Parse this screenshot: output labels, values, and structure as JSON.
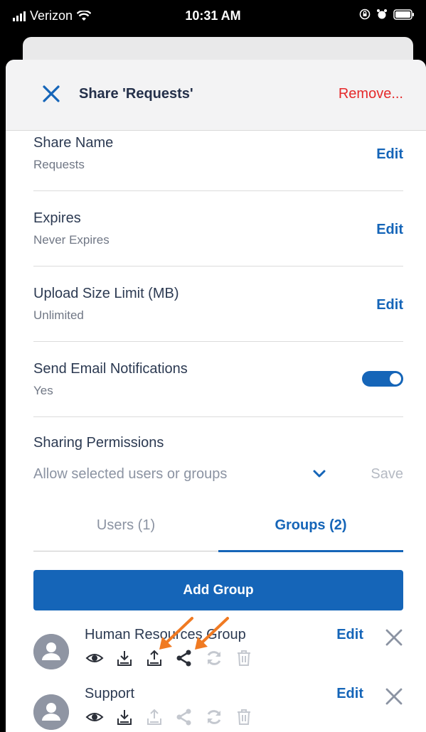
{
  "status_bar": {
    "carrier": "Verizon",
    "time": "10:31 AM"
  },
  "header": {
    "title": "Share 'Requests'",
    "remove_label": "Remove..."
  },
  "settings": [
    {
      "label": "Share Name",
      "value": "Requests",
      "action": "Edit"
    },
    {
      "label": "Expires",
      "value": "Never Expires",
      "action": "Edit"
    },
    {
      "label": "Upload Size Limit (MB)",
      "value": "Unlimited",
      "action": "Edit"
    },
    {
      "label": "Send Email Notifications",
      "value": "Yes",
      "toggle_on": true
    }
  ],
  "permissions": {
    "label": "Sharing Permissions",
    "selected": "Allow selected users or groups",
    "save_label": "Save"
  },
  "tabs": [
    {
      "label": "Users (1)",
      "active": false
    },
    {
      "label": "Groups (2)",
      "active": true
    }
  ],
  "add_group_label": "Add Group",
  "groups": [
    {
      "name": "Human Resources Group",
      "edit_label": "Edit",
      "permissions": {
        "view": true,
        "download": true,
        "upload": true,
        "share": true,
        "sync": false,
        "delete": false
      }
    },
    {
      "name": "Support",
      "edit_label": "Edit",
      "permissions": {
        "view": true,
        "download": true,
        "upload": false,
        "share": false,
        "sync": false,
        "delete": false
      }
    }
  ],
  "colors": {
    "accent": "#1565b8",
    "danger": "#e5292a",
    "annotation_arrow": "#f07a22",
    "enabled_icon": "#2b2f38",
    "disabled_icon": "#c4c8cf"
  }
}
